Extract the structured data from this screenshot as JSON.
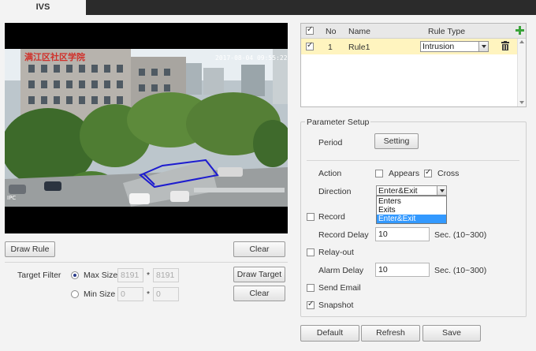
{
  "tabs": [
    "IVS"
  ],
  "video": {
    "overlay_timestamp": "2017-08-04 09:55:22",
    "building_sign": "满江区社区学院",
    "corner_label": "IPC"
  },
  "rule_table": {
    "columns": {
      "select": "",
      "no": "No",
      "name": "Name",
      "rule_type": "Rule Type"
    },
    "rows": [
      {
        "checked": true,
        "no": "1",
        "name": "Rule1",
        "rule_type": "Intrusion"
      }
    ],
    "add_icon": "plus-icon",
    "delete_icon": "trash-icon"
  },
  "left_controls": {
    "draw_rule": "Draw Rule",
    "clear_top": "Clear",
    "target_filter_label": "Target Filter",
    "max_size_label": "Max Size",
    "max_w": "8191",
    "max_h": "8191",
    "min_size_label": "Min Size",
    "min_w": "0",
    "min_h": "0",
    "times": "*",
    "draw_target": "Draw Target",
    "clear_bottom": "Clear"
  },
  "params": {
    "title": "Parameter Setup",
    "period_label": "Period",
    "setting_button": "Setting",
    "action_label": "Action",
    "appears_label": "Appears",
    "cross_label": "Cross",
    "direction_label": "Direction",
    "direction_value": "Enter&Exit",
    "direction_options": [
      "Enters",
      "Exits",
      "Enter&Exit"
    ],
    "record_label": "Record",
    "record_delay_label": "Record Delay",
    "record_delay_value": "10",
    "record_delay_unit": "Sec. (10~300)",
    "relay_out_label": "Relay-out",
    "alarm_delay_label": "Alarm Delay",
    "alarm_delay_value": "10",
    "alarm_delay_unit": "Sec. (10~300)",
    "send_email_label": "Send Email",
    "snapshot_label": "Snapshot"
  },
  "footer": {
    "default": "Default",
    "refresh": "Refresh",
    "save": "Save"
  }
}
